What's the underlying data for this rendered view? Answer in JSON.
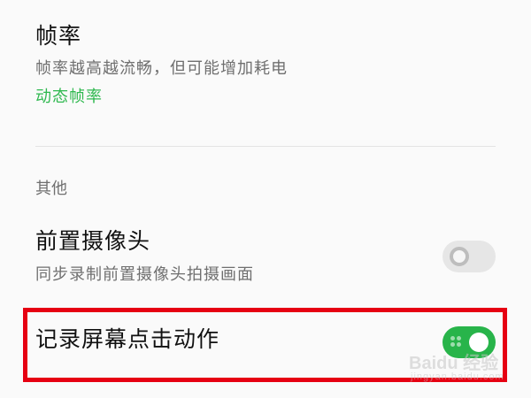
{
  "colors": {
    "accent_green": "#28b44a",
    "link_green": "#2fb84f",
    "highlight_red": "#e60012"
  },
  "framerate": {
    "title": "帧率",
    "description": "帧率越高越流畅，但可能增加耗电",
    "value_link": "动态帧率"
  },
  "section_other": {
    "header": "其他"
  },
  "front_camera": {
    "title": "前置摄像头",
    "description": "同步录制前置摄像头拍摄画面",
    "toggle_state": "off"
  },
  "record_taps": {
    "title": "记录屏幕点击动作",
    "toggle_state": "on"
  },
  "watermark": {
    "text": "Baidu 经验",
    "sub": "jingyan.baidu.com"
  }
}
